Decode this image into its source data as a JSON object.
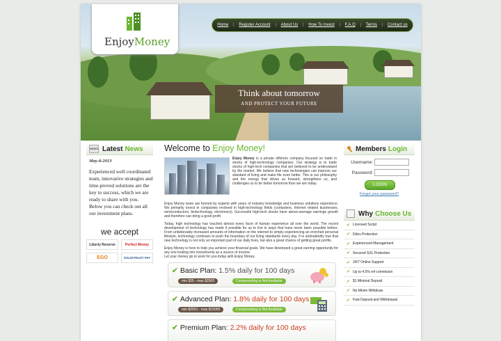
{
  "brand": {
    "name_part1": "Enjoy",
    "name_part2": "Money"
  },
  "nav": [
    "Home",
    "Register Account",
    "About Us",
    "How To Invest",
    "F.A.Q",
    "Terms",
    "Contact us"
  ],
  "slogan": {
    "main": "Think about tomorrow",
    "sub": "AND PROTECT YOUR FUTURE"
  },
  "news": {
    "title_part1": "Latest",
    "title_part2": "News",
    "icon_label": "NEWS",
    "date": "May-8-2013",
    "text": "Experienced  well coordinated team, innovative strategies and time-proved solutions are the key to success, which we are ready to share with you. Below you can check out all our investment plans."
  },
  "accept": {
    "title": "we accept",
    "logos": [
      "Liberty Reserve",
      "Perfect Money",
      "EGO",
      "SOLIDTRUST PAY"
    ]
  },
  "welcome": {
    "part1": "Welcome to",
    "part2": "Enjoy Money!"
  },
  "main_text": {
    "intro_strong": "Enjoy Money",
    "intro": " is a private offshore company focused on trade in stocks of high-technology companies. Our strategy is to trade stocks of high-tech companies that are believed to be undervalued by the market. We believe that new technologies can improve our standard of living and make life even better. This is our philosophy and the energy that drives us forward, strengthens us, and challenges us to be better tomorrow than we are today.",
    "p1": "Enjoy Money team are formed by experts with years of industry knowledge and business solutions experience. We primarily invest in companies involved in high-technology fields (computers, Internet related businesses, semiconductors, biotechnology, electronics). Successful high-tech stocks have above-average earnings growth and therefore can bring a good profit.",
    "p2": "Today, high technology has touched almost every facet of human experience all over the world. The recent development of technology has made it possible for us to live in ways that have never been possible before. From unbelievably increased amounts of information on the internet to simply experiencing an enriched personal lifestyle, technology continues to push the boundary of our living standards every day. It is undoubtedly true that new technology is not only an important part of our daily lives, but also a great chance of getting great profits.",
    "p3": "Enjoy Money is here to help you achieve your financial goals. We have developed a great earning opportunity for any one looking into investments as a source of income.",
    "p4": "Let your money go to work for you today with Enjoy Money."
  },
  "plans": [
    {
      "name": "Basic Plan:",
      "rate": "1.5% daily for 100 days",
      "min_max": "min $25  -  max $2500",
      "compounding": "Compounding is Not Available",
      "icon": "piggy-bank-icon"
    },
    {
      "name": "Advanced Plan:",
      "rate": "1.8% daily for 100 days",
      "min_max": "min $2501  -  max $15000",
      "compounding": "Compounding is Not Available",
      "icon": "money-calculator-icon"
    },
    {
      "name": "Premium Plan:",
      "rate": "2.2% daily for 100 days",
      "min_max": "",
      "compounding": "",
      "icon": ""
    }
  ],
  "login": {
    "title_part1": "Members",
    "title_part2": "Login",
    "username_label": "Username:",
    "password_label": "Password:",
    "button": "LOGIN",
    "forgot": "Forgot your password?"
  },
  "why": {
    "title_part1": "Why",
    "title_part2": "Choose Us",
    "items": [
      "Licensed Script",
      "Ddos Protection",
      "Experienced Management",
      "Secured SSL Protection",
      "24/7 Online Support",
      "Up to 4.5% ref commision",
      "$1 Minimal Deposit",
      "No Minim Withdraw",
      "Fast Deposit and Withdrawal"
    ]
  },
  "colors": {
    "accent": "#6ab531",
    "brown": "#6a5648",
    "red_rate": "#cc3d1b",
    "link": "#3a78b0"
  }
}
